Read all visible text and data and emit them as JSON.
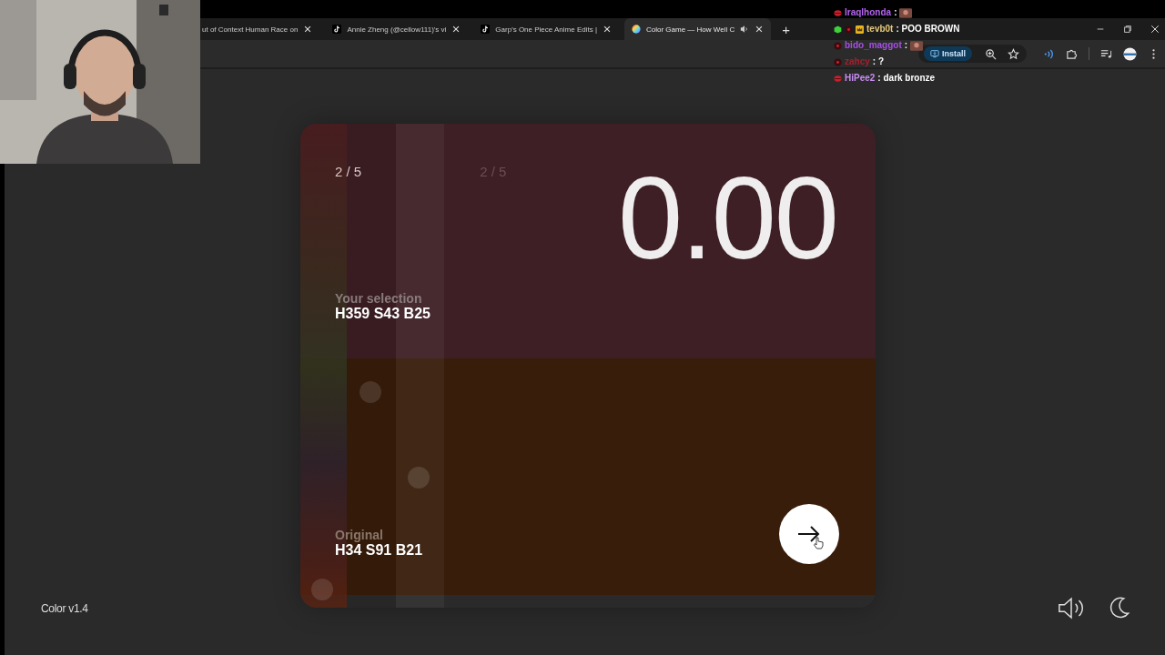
{
  "stream_overlay": {
    "chat": [
      {
        "user": "Iraqlhonda",
        "color": "#b463f0",
        "kind": "lips",
        "message": ":",
        "emote": true
      },
      {
        "user": "tevb0t",
        "color": "#e6c87a",
        "kind": "crown",
        "message": ": POO BROWN",
        "emote": false
      },
      {
        "user": "bido_maggot",
        "color": "#a64fe6",
        "kind": "dot",
        "message": ":",
        "emote": true
      },
      {
        "user": "zahcy",
        "color": "#a81f2c",
        "kind": "dot",
        "message": ": ?",
        "emote": false
      },
      {
        "user": "HiPee2",
        "color": "#c98df5",
        "kind": "lips",
        "message": ": dark bronze",
        "emote": false
      }
    ]
  },
  "browser": {
    "tabs": [
      {
        "title": "ut of Context Human Race on",
        "selected": false,
        "kind": "plain",
        "audio": false
      },
      {
        "title": "Annie Zheng (@cellow111)'s vi",
        "selected": false,
        "kind": "video",
        "audio": false
      },
      {
        "title": "Garp's One Piece Anime Edits |",
        "selected": false,
        "kind": "video",
        "audio": false
      },
      {
        "title": "Color Game — How Well C",
        "selected": true,
        "kind": "game",
        "audio": true
      }
    ],
    "new_tab": "+",
    "install_button": "Install"
  },
  "game": {
    "round": "2 / 5",
    "ghost_round": "2 / 5",
    "score": "0.00",
    "selection": {
      "label": "Your selection",
      "value": "H359 S43 B25"
    },
    "original": {
      "label": "Original",
      "value": "H34 S91 B21"
    }
  },
  "footer": {
    "version": "Color v1.4"
  }
}
